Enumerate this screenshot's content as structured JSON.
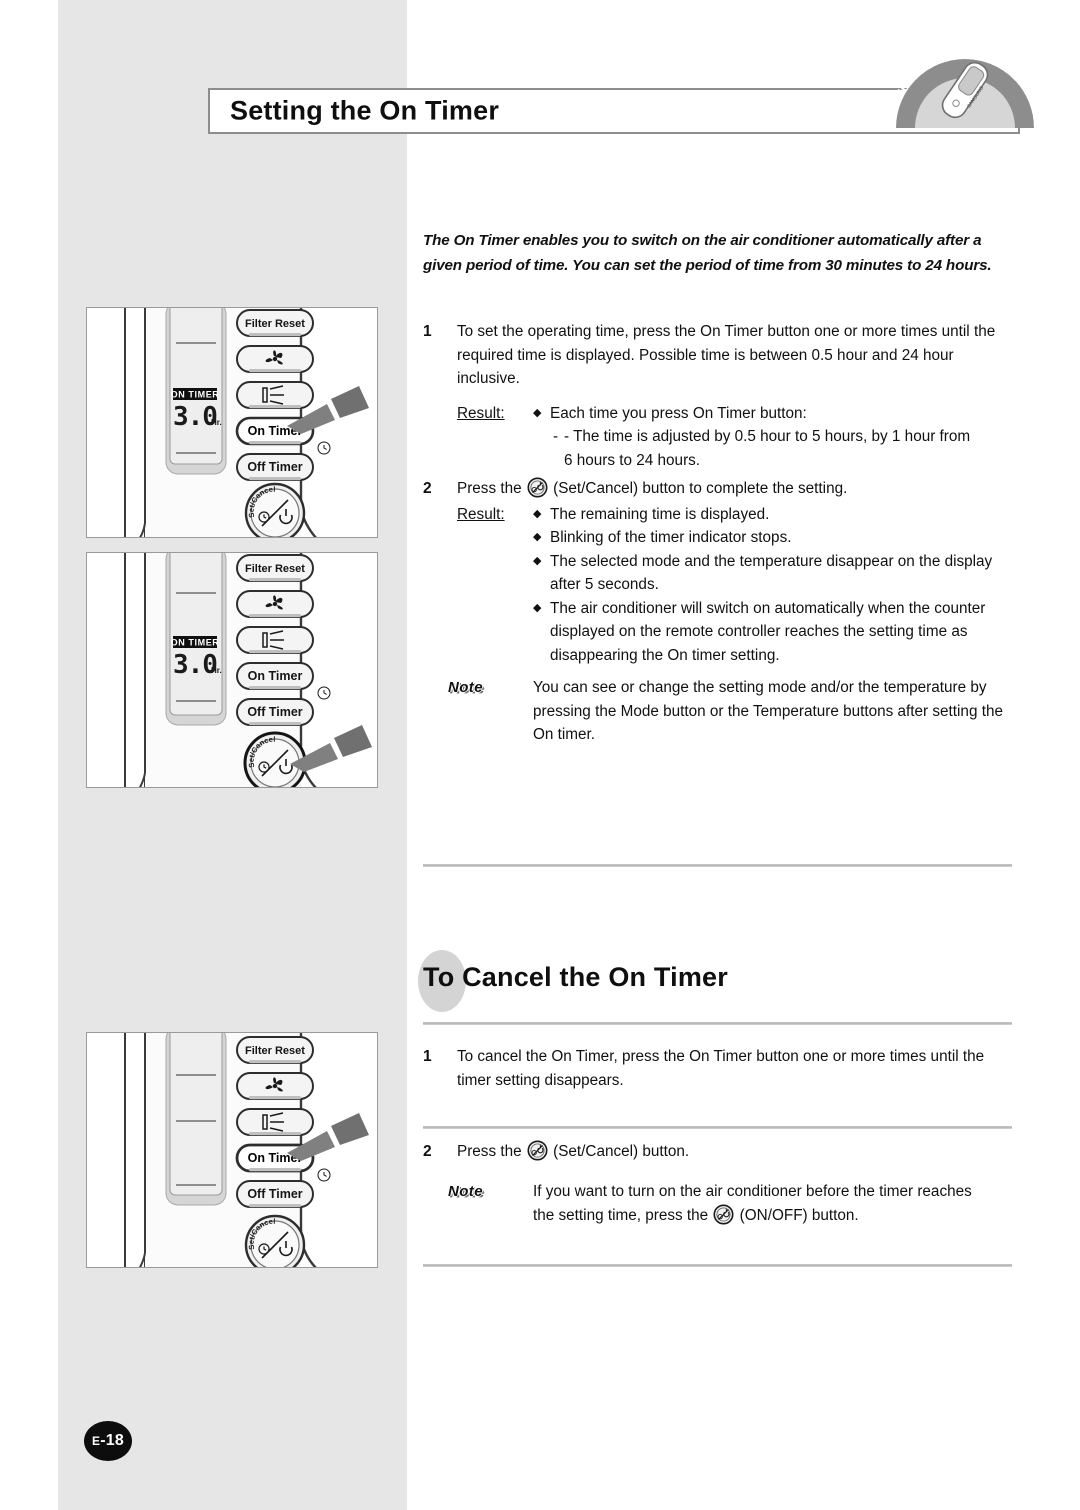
{
  "page": {
    "title": "Setting the On Timer",
    "page_number": "E-18",
    "page_number_prefix": "E",
    "page_number_value": "-18",
    "badge_text": "Wireless Remote Controller",
    "brand_on_remote": "SAMSUNG"
  },
  "intro": "The On Timer enables you to switch on the air conditioner automatically after a given period of time. You can set the period of time from 30 minutes to 24 hours.",
  "section1": {
    "steps": [
      {
        "num": "1",
        "text": "To set the operating time, press the On Timer button one or more times until the required time is displayed. Possible time is between 0.5 hour and 24 hour inclusive.",
        "result_label": "Result:",
        "results": [
          "Each time you press On Timer button:"
        ],
        "sub_result_line1": "- The time is adjusted by 0.5 hour to 5 hours, by 1 hour from",
        "sub_result_line2": "6 hours to 24 hours."
      },
      {
        "num": "2",
        "text_before_icon": "Press the ",
        "icon_name": "set-cancel-icon",
        "text_after_icon": " (Set/Cancel) button to complete the setting.",
        "result_label": "Result:",
        "results": [
          "The remaining time is displayed.",
          "Blinking of the timer indicator stops.",
          "The selected mode and the temperature disappear on the display after 5 seconds.",
          "The air conditioner will switch on automatically when the counter displayed on the remote controller reaches the setting time as disappearing the On timer setting."
        ]
      }
    ],
    "note": {
      "tag": "Note",
      "text": "You can see or change the setting mode and/or the temperature by pressing the Mode button or the Temperature buttons after setting the On timer."
    }
  },
  "section2": {
    "heading": "To Cancel the On Timer",
    "steps": [
      {
        "num": "1",
        "text": "To cancel the On Timer, press the On Timer button one or more times until the timer setting disappears."
      },
      {
        "num": "2",
        "text_before_icon": "Press the ",
        "icon_name": "set-cancel-icon",
        "text_after_icon": " (Set/Cancel) button."
      }
    ],
    "note": {
      "tag": "Note",
      "text_line1": "If you want to turn on the air conditioner before the timer reaches",
      "text_before_icon": "the setting time, press the ",
      "icon_name": "on-off-icon",
      "text_after_icon": " (ON/OFF) button."
    }
  },
  "figures": [
    {
      "id": "figure-1",
      "display": {
        "indicator": "ON TIMER",
        "value": "3.0",
        "unit": "Hr."
      },
      "buttons": [
        "Filter Reset",
        "fan-icon",
        "swing-icon",
        "On Timer",
        "Off Timer",
        "Set/Cancel"
      ],
      "set_cancel_label": "Set/Cancel",
      "pointer_target": "On Timer"
    },
    {
      "id": "figure-2",
      "display": {
        "indicator": "ON TIMER",
        "value": "3.0",
        "unit": "Hr."
      },
      "buttons": [
        "Filter Reset",
        "fan-icon",
        "swing-icon",
        "On Timer",
        "Off Timer",
        "Set/Cancel"
      ],
      "set_cancel_label": "Set/Cancel",
      "pointer_target": "Set/Cancel"
    },
    {
      "id": "figure-3",
      "display": {
        "indicator": "",
        "value": "",
        "unit": ""
      },
      "buttons": [
        "Filter Reset",
        "fan-icon",
        "swing-icon",
        "On Timer",
        "Off Timer",
        "Set/Cancel"
      ],
      "set_cancel_label": "Set/Cancel",
      "pointer_target": "On Timer"
    }
  ],
  "colors": {
    "panel_gray": "#e6e6e6",
    "divider": "#bfbfbf",
    "ink": "#111111",
    "badge_gray": "#8a8a8a",
    "heading_ellipse": "#d4d4d4"
  }
}
